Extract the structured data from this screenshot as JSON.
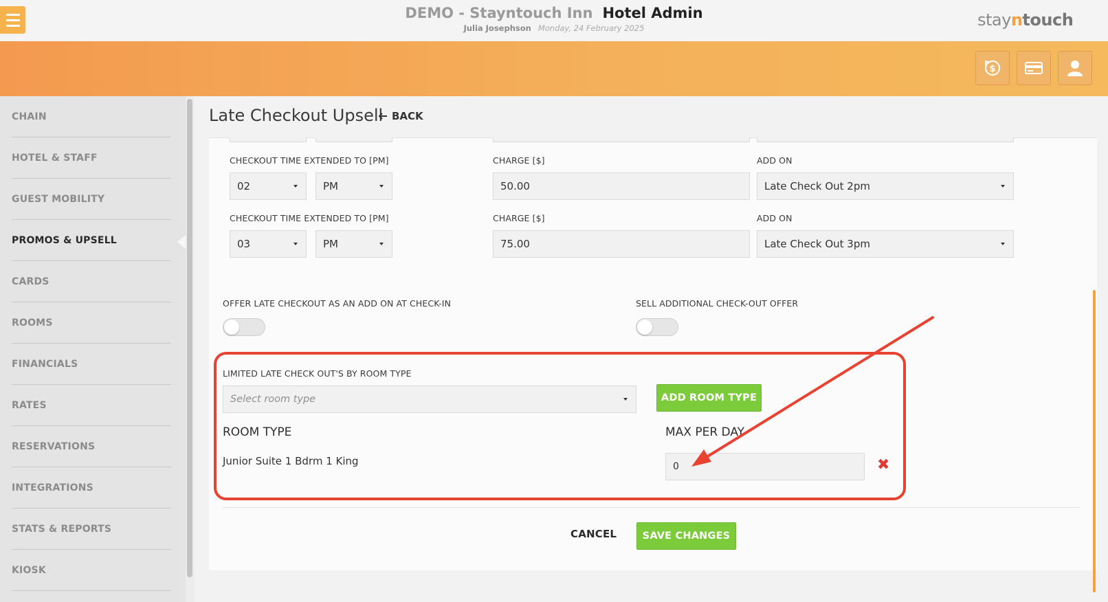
{
  "header": {
    "demo_title": "DEMO - Stayntouch Inn",
    "app_title": "Hotel Admin",
    "user": "Julia Josephson",
    "date": "Monday, 24 February 2025",
    "logo_pre": "stay",
    "logo_n": "n",
    "logo_post": "touch",
    "buttons": [
      {
        "icon": "dollar-refresh-icon"
      },
      {
        "icon": "credit-card-icon"
      },
      {
        "icon": "user-icon"
      }
    ]
  },
  "sidebar": {
    "items": [
      {
        "label": "CHAIN"
      },
      {
        "label": "HOTEL & STAFF"
      },
      {
        "label": "GUEST MOBILITY"
      },
      {
        "label": "PROMOS & UPSELL",
        "active": true
      },
      {
        "label": "CARDS"
      },
      {
        "label": "ROOMS"
      },
      {
        "label": "FINANCIALS"
      },
      {
        "label": "RATES"
      },
      {
        "label": "RESERVATIONS"
      },
      {
        "label": "INTEGRATIONS"
      },
      {
        "label": "STATS & REPORTS"
      },
      {
        "label": "KIOSK"
      }
    ]
  },
  "page": {
    "title": "Late Checkout Upsell",
    "back_label": "BACK"
  },
  "checkout_rows": [
    {
      "time_label": "CHECKOUT TIME EXTENDED TO [PM]",
      "hour": "02",
      "ampm": "PM",
      "charge_label": "CHARGE [$]",
      "charge": "50.00",
      "addon_label": "ADD ON",
      "addon": "Late Check Out 2pm"
    },
    {
      "time_label": "CHECKOUT TIME EXTENDED TO [PM]",
      "hour": "03",
      "ampm": "PM",
      "charge_label": "CHARGE [$]",
      "charge": "75.00",
      "addon_label": "ADD ON",
      "addon": "Late Check Out 3pm"
    }
  ],
  "toggles": {
    "offer_addon_label": "OFFER LATE CHECKOUT AS AN ADD ON AT CHECK-IN",
    "offer_addon_on": false,
    "sell_additional_label": "SELL ADDITIONAL CHECK-OUT OFFER",
    "sell_additional_on": false
  },
  "room_limits": {
    "section_label": "LIMITED LATE CHECK OUT'S BY ROOM TYPE",
    "select_placeholder": "Select room type",
    "add_button": "ADD ROOM TYPE",
    "col_room_type": "ROOM TYPE",
    "col_max_per_day": "MAX PER DAY",
    "rows": [
      {
        "room_type": "Junior Suite 1 Bdrm 1 King",
        "max_per_day": "0"
      }
    ]
  },
  "actions": {
    "cancel": "CANCEL",
    "save": "SAVE CHANGES"
  },
  "colors": {
    "accent_orange": "#f6a13b",
    "save_green": "#7ccb3b",
    "annotation_red": "#e84332",
    "delete_red": "#dd3b36"
  }
}
